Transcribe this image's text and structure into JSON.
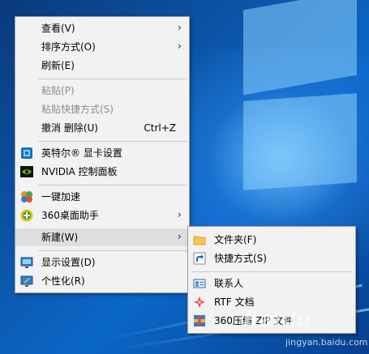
{
  "context_menu": {
    "items": [
      {
        "label": "查看(V)",
        "has_submenu": true
      },
      {
        "label": "排序方式(O)",
        "has_submenu": true
      },
      {
        "label": "刷新(E)"
      },
      {
        "label": "粘贴(P)",
        "disabled": true
      },
      {
        "label": "粘贴快捷方式(S)",
        "disabled": true
      },
      {
        "label": "撤消 删除(U)",
        "shortcut": "Ctrl+Z"
      },
      {
        "label": "英特尔® 显卡设置",
        "icon": "intel-graphics-icon"
      },
      {
        "label": "NVIDIA 控制面板",
        "icon": "nvidia-icon"
      },
      {
        "label": "一键加速",
        "icon": "speedup-icon"
      },
      {
        "label": "360桌面助手",
        "icon": "360-desktop-icon",
        "has_submenu": true
      },
      {
        "label": "新建(W)",
        "has_submenu": true,
        "highlighted": true
      },
      {
        "label": "显示设置(D)",
        "icon": "display-settings-icon"
      },
      {
        "label": "个性化(R)",
        "icon": "personalize-icon"
      }
    ],
    "arrow_glyph": "›"
  },
  "new_submenu": {
    "items": [
      {
        "label": "文件夹(F)",
        "icon": "folder-icon"
      },
      {
        "label": "快捷方式(S)",
        "icon": "shortcut-icon"
      },
      {
        "label": "联系人",
        "icon": "contact-icon"
      },
      {
        "label": "RTF 文档",
        "icon": "rtf-document-icon"
      },
      {
        "label": "360压缩 ZIP 文件",
        "icon": "zip-archive-icon"
      }
    ]
  },
  "watermark": {
    "logo_text": "Baidu",
    "site": "jingyan.baidu.com"
  },
  "colors": {
    "menu_bg": "#f2f2f2",
    "highlight": "#dedede",
    "disabled_text": "#8a8a8a"
  }
}
